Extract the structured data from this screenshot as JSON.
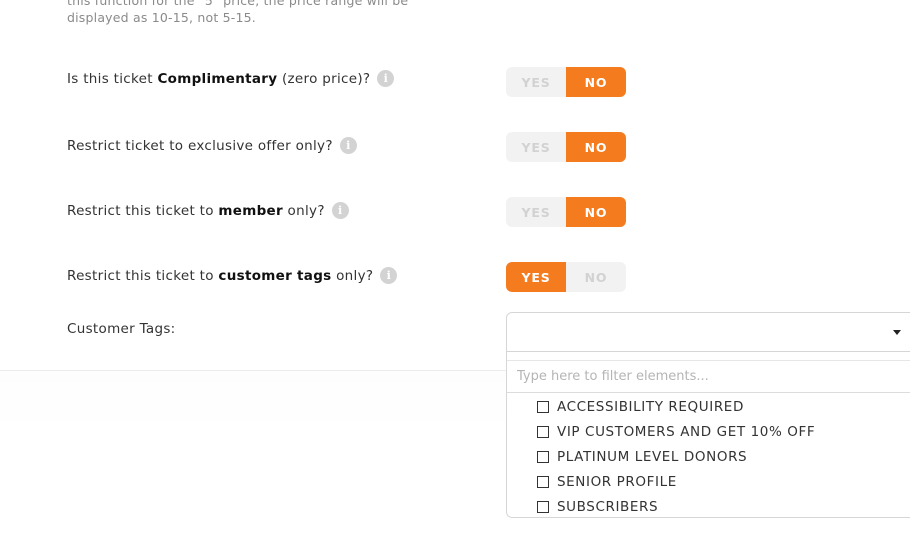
{
  "intro": {
    "line1": "this function for the \"5\" price, the price range will be",
    "line2": "displayed as 10-15, not 5-15."
  },
  "rows": [
    {
      "before": "Is this ticket ",
      "bold": "Complimentary",
      "after": " (zero price)?",
      "yes": "YES",
      "no": "NO",
      "selected": "NO"
    },
    {
      "before": "Restrict ticket to exclusive offer only?",
      "bold": "",
      "after": "",
      "yes": "YES",
      "no": "NO",
      "selected": "NO"
    },
    {
      "before": "Restrict this ticket to ",
      "bold": "member",
      "after": " only?",
      "yes": "YES",
      "no": "NO",
      "selected": "NO"
    },
    {
      "before": "Restrict this ticket to ",
      "bold": "customer tags",
      "after": " only?",
      "yes": "YES",
      "no": "NO",
      "selected": "YES"
    }
  ],
  "info_icon": {
    "glyph": "i",
    "icon": "info-icon"
  },
  "customer_tags": {
    "label": "Customer Tags:",
    "selected_value": "",
    "filter_placeholder": "Type here to filter elements...",
    "options": [
      "ACCESSIBILITY REQUIRED",
      "VIP CUSTOMERS AND GET 10% OFF",
      "PLATINUM LEVEL DONORS",
      "SENIOR PROFILE",
      "SUBSCRIBERS"
    ]
  },
  "colors": {
    "accent": "#f57b1f",
    "toggle_off_bg": "#f2f2f2",
    "toggle_off_text": "#d2d2d2"
  }
}
